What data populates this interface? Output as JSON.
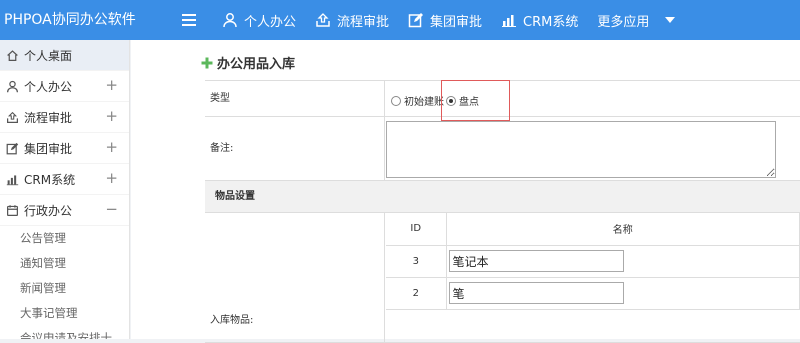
{
  "app": {
    "brand": "PHPOA协同办公软件"
  },
  "topnav": {
    "items": [
      {
        "label": "个人办公",
        "icon": "user-icon"
      },
      {
        "label": "流程审批",
        "icon": "workflow-icon"
      },
      {
        "label": "集团审批",
        "icon": "edit-icon"
      },
      {
        "label": "CRM系统",
        "icon": "bar-chart-icon"
      },
      {
        "label": "更多应用",
        "icon": "caret-down-icon"
      }
    ]
  },
  "sidebar": {
    "items": [
      {
        "label": "个人桌面",
        "icon": "home-icon",
        "toggle": ""
      },
      {
        "label": "个人办公",
        "icon": "user-icon",
        "toggle": "+"
      },
      {
        "label": "流程审批",
        "icon": "workflow-icon",
        "toggle": "+"
      },
      {
        "label": "集团审批",
        "icon": "edit-icon",
        "toggle": "+"
      },
      {
        "label": "CRM系统",
        "icon": "bar-chart-icon",
        "toggle": "+"
      },
      {
        "label": "行政办公",
        "icon": "calendar-icon",
        "toggle": "−"
      }
    ],
    "subitems": [
      "公告管理",
      "通知管理",
      "新闻管理",
      "大事记管理",
      "会议申请及安排十"
    ]
  },
  "page": {
    "title": "办公用品入库",
    "form": {
      "type_label": "类型",
      "type_options": [
        "初始建账",
        "盘点"
      ],
      "type_selected": "盘点",
      "note_label": "备注:",
      "note_value": "",
      "section_label": "物品设置",
      "items_label": "入库物品:",
      "items_table": {
        "headers": [
          "ID",
          "名称"
        ],
        "rows": [
          {
            "id": "3",
            "name": "笔记本"
          },
          {
            "id": "2",
            "name": "笔"
          }
        ]
      }
    }
  },
  "colors": {
    "topbar": "#3a8ee6",
    "highlight": "#e05a5a"
  }
}
